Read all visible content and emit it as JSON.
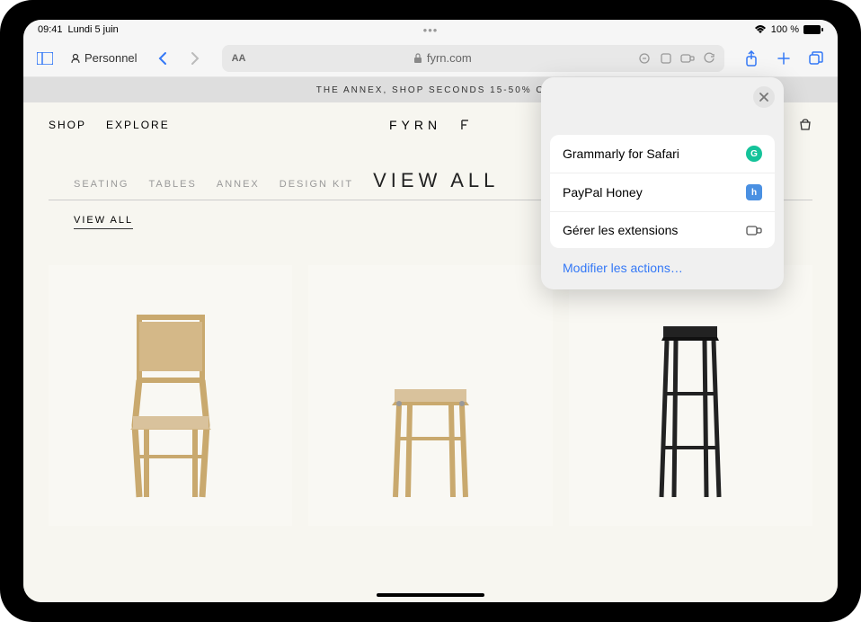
{
  "status": {
    "time": "09:41",
    "date": "Lundi 5 juin",
    "battery": "100 %"
  },
  "toolbar": {
    "profile_label": "Personnel",
    "text_size_label": "AA",
    "url": "fyrn.com"
  },
  "page": {
    "promo": "THE ANNEX, SHOP SECONDS 15-50% O",
    "nav": {
      "shop": "SHOP",
      "explore": "EXPLORE"
    },
    "logo": "FYRN",
    "categories": {
      "seating": "SEATING",
      "tables": "TABLES",
      "annex": "ANNEX",
      "design_kit": "DESIGN KIT",
      "view_all": "VIEW ALL"
    },
    "view_all_sub": "VIEW ALL"
  },
  "popover": {
    "items": [
      {
        "label": "Grammarly for Safari",
        "icon": "G",
        "color": "#15c39a"
      },
      {
        "label": "PayPal Honey",
        "icon": "h",
        "color": "#4a90e2"
      }
    ],
    "manage": "Gérer les extensions",
    "edit_actions": "Modifier les actions…"
  }
}
